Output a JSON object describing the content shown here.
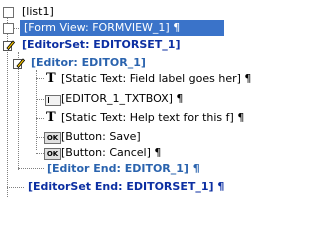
{
  "tree": {
    "root_label": "[list1]",
    "form_view": "[Form View: FORMVIEW_1] ¶",
    "editor_set": "[EditorSet: EDITORSET_1]",
    "editor": "[Editor: EDITOR_1]",
    "static_field_label": "[Static Text: Field label goes her] ¶",
    "txtbox": "[EDITOR_1_TXTBOX] ¶",
    "static_help": "[Static Text: Help text for this f] ¶",
    "button_save": "[Button: Save]",
    "button_cancel": "[Button: Cancel] ¶",
    "editor_end": "[Editor End: EDITOR_1] ¶",
    "editor_set_end": "[EditorSet End: EDITORSET_1] ¶"
  },
  "icons": {
    "ok_text": "OK",
    "t_text": "T"
  },
  "colors": {
    "selection": "#3a73c9",
    "editor_set_blue": "#0c2fa2",
    "editor_blue": "#2a63ae"
  }
}
